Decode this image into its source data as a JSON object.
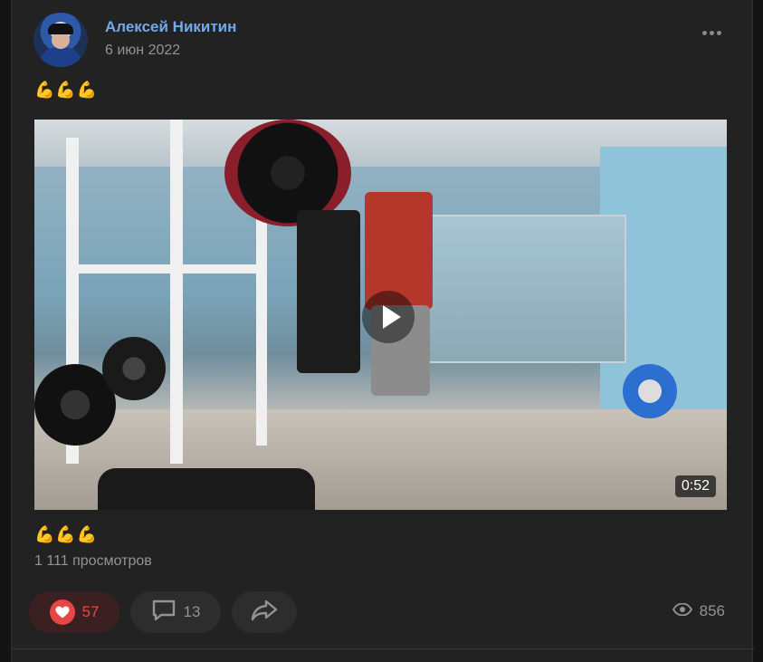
{
  "post": {
    "author": "Алексей Никитин",
    "date": "6 июн 2022",
    "text_top": "💪💪💪",
    "text_bottom": "💪💪💪",
    "views_line": "1 111 просмотров"
  },
  "video": {
    "duration": "0:52"
  },
  "actions": {
    "likes": "57",
    "comments": "13",
    "views": "856"
  },
  "icons": {
    "more": "more-icon",
    "like": "heart-icon",
    "comment": "comment-icon",
    "share": "share-icon",
    "views": "eye-icon",
    "play": "play-icon"
  },
  "colors": {
    "author": "#71aaeb",
    "like_accent": "#e64646"
  }
}
